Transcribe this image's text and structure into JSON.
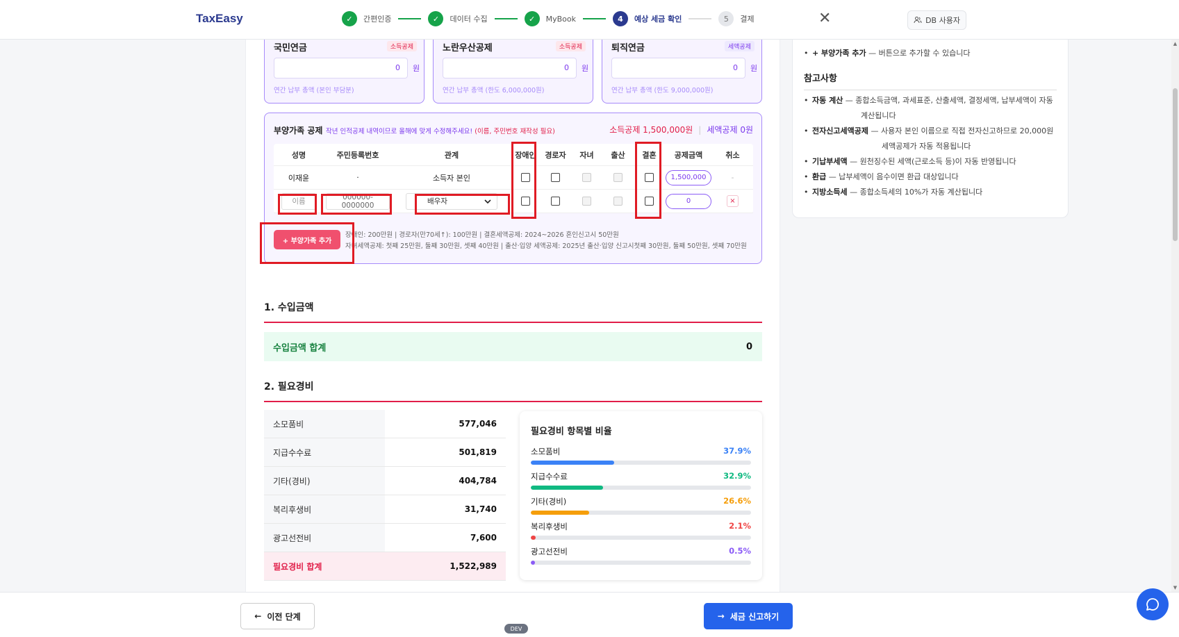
{
  "header": {
    "brand": "TaxEasy",
    "steps": [
      {
        "num": "✓",
        "label": "간편인증",
        "state": "done"
      },
      {
        "num": "✓",
        "label": "데이터 수집",
        "state": "done"
      },
      {
        "num": "✓",
        "label": "MyBook",
        "state": "done"
      },
      {
        "num": "4",
        "label": "예상 세금 확인",
        "state": "active"
      },
      {
        "num": "5",
        "label": "결제",
        "state": "todo"
      }
    ],
    "db_user": "DB 사용자"
  },
  "pensions": [
    {
      "title": "국민연금",
      "badge": "소득공제",
      "badge_type": "red",
      "value": "0",
      "unit": "원",
      "hint": "연간 납부 총액 (본인 부담분)"
    },
    {
      "title": "노란우산공제",
      "badge": "소득공제",
      "badge_type": "red",
      "value": "0",
      "unit": "원",
      "hint": "연간 납부 총액 (한도 6,000,000원)"
    },
    {
      "title": "퇴직연금",
      "badge": "세액공제",
      "badge_type": "purple",
      "value": "0",
      "unit": "원",
      "hint": "연간 납부 총액 (한도 9,000,000원)"
    }
  ],
  "dependents": {
    "title": "부양가족 공제",
    "note": "작년 인적공제 내역이므로 올해에 맞게 수정해주세요!",
    "note_red": "(이름, 주민번호 재작성 필요)",
    "income_deduction": "소득공제 1,500,000원",
    "tax_deduction": "세액공제 0원",
    "headers": [
      "성명",
      "주민등록번호",
      "관계",
      "장애인",
      "경로자",
      "자녀",
      "출산",
      "결혼",
      "공제금액",
      "취소"
    ],
    "row1": {
      "name": "이재윤",
      "rrn": "·",
      "relation": "소득자 본인",
      "amount": "1,500,000",
      "cancel": "-"
    },
    "row2": {
      "name_placeholder": "이름",
      "rrn_placeholder": "000000-0000000",
      "relation": "배우자",
      "amount": "0",
      "cancel": "×"
    },
    "add_button": "+ 부양가족 추가",
    "foot1": "장애인: 200만원 | 경로자(만70세↑): 100만원 | 결혼세액공제: 2024~2026 혼인신고시 50만원",
    "foot2": "자녀세액공제: 첫째 25만원, 둘째 30만원, 셋째 40만원 | 출산·입양 세액공제: 2025년 출산·입양 신고시첫째 30만원, 둘째 50만원, 셋째 70만원"
  },
  "income": {
    "title": "1. 수입금액",
    "total_label": "수입금액 합계",
    "total_value": "0"
  },
  "expenses": {
    "title": "2. 필요경비",
    "rows": [
      {
        "label": "소모품비",
        "value": "577,046"
      },
      {
        "label": "지급수수료",
        "value": "501,819"
      },
      {
        "label": "기타(경비)",
        "value": "404,784"
      },
      {
        "label": "복리후생비",
        "value": "31,740"
      },
      {
        "label": "광고선전비",
        "value": "7,600"
      }
    ],
    "total_label": "필요경비 합계",
    "total_value": "1,522,989"
  },
  "ratio": {
    "title": "필요경비 항목별 비율",
    "items": [
      {
        "label": "소모품비",
        "pct": "37.9%",
        "value": 37.9,
        "color": "#3b82f6"
      },
      {
        "label": "지급수수료",
        "pct": "32.9%",
        "value": 32.9,
        "color": "#10b981"
      },
      {
        "label": "기타(경비)",
        "pct": "26.6%",
        "value": 26.6,
        "color": "#f59e0b"
      },
      {
        "label": "복리후생비",
        "pct": "2.1%",
        "value": 2.1,
        "color": "#ef4444"
      },
      {
        "label": "광고선전비",
        "pct": "0.5%",
        "value": 0.5,
        "color": "#8b5cf6"
      }
    ]
  },
  "right_panel": {
    "top_item_bold": "+ 부양가족 추가",
    "top_item_text": " — 버튼으로 추가할 수 있습니다",
    "notes_title": "참고사항",
    "notes": [
      {
        "bold": "자동 계산",
        "text": " — 종합소득금액, 과세표준, 산출세액, 결정세액, 납부세액이 자동",
        "cont": "계산됩니다"
      },
      {
        "bold": "전자신고세액공제",
        "text": " — 사용자 본인 이름으로 직접 전자신고하므로 20,000원",
        "cont": "세액공제가 자동 적용됩니다"
      },
      {
        "bold": "기납부세액",
        "text": " — 원천징수된 세액(근로소득 등)이 자동 반영됩니다",
        "cont": ""
      },
      {
        "bold": "환급",
        "text": " — 납부세액이 음수이면 환급 대상입니다",
        "cont": ""
      },
      {
        "bold": "지방소득세",
        "text": " — 종합소득세의 10%가 자동 계산됩니다",
        "cont": ""
      }
    ]
  },
  "footer": {
    "prev": "이전 단계",
    "next": "세금 신고하기",
    "dev": "DEV"
  }
}
